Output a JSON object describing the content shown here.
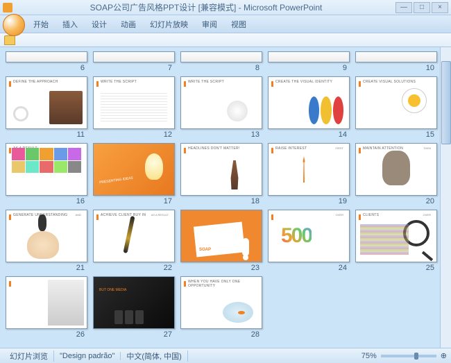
{
  "window": {
    "title": "SOAP公司广告风格PPT设计 [兼容模式] - Microsoft PowerPoint",
    "minimize": "—",
    "maximize": "□",
    "close": "×"
  },
  "ribbon": {
    "tabs": [
      "开始",
      "插入",
      "设计",
      "动画",
      "幻灯片放映",
      "审阅",
      "视图"
    ]
  },
  "slides": [
    {
      "num": "6"
    },
    {
      "num": "7"
    },
    {
      "num": "8"
    },
    {
      "num": "9"
    },
    {
      "num": "10"
    },
    {
      "num": "11",
      "title": "DEFINE THE APPROACH"
    },
    {
      "num": "12",
      "title": "WRITE THE SCRIPT"
    },
    {
      "num": "13",
      "title": "WRITE THE SCRIPT"
    },
    {
      "num": "14",
      "title": "CREATE THE VISUAL IDENTITY"
    },
    {
      "num": "15",
      "title": "CREATE VISUAL SOLUTIONS"
    },
    {
      "num": "16",
      "title": "AS A RESULT"
    },
    {
      "num": "17",
      "title": "PRESENTING IDEAS"
    },
    {
      "num": "18",
      "title": "HEADLINES DON'T MATTER!"
    },
    {
      "num": "19",
      "title": "RAISE INTEREST",
      "sub": "FIRST"
    },
    {
      "num": "20",
      "title": "MAINTAIN ATTENTION",
      "sub": "THEN"
    },
    {
      "num": "21",
      "title": "GENERATE UNDERSTANDING",
      "sub": "AND"
    },
    {
      "num": "22",
      "title": "ACHIEVE CLIENT BUY IN",
      "sub": "AS A RESULT"
    },
    {
      "num": "23",
      "title": "SOAP"
    },
    {
      "num": "24",
      "title": "500",
      "sub": "OVER"
    },
    {
      "num": "25",
      "title": "CLIENTS",
      "sub": "OVER"
    },
    {
      "num": "26"
    },
    {
      "num": "27",
      "title": "BUT ONE MEDIA"
    },
    {
      "num": "28",
      "title": "WHEN YOU HAVE ONLY ONE OPPORTUNITY"
    }
  ],
  "statusbar": {
    "view_mode": "幻灯片浏览",
    "template": "\"Design padrão\"",
    "ime": "中文(简体, 中国)",
    "zoom": "75%",
    "fit": "⊕"
  },
  "colors": {
    "accent": "#f08020"
  }
}
